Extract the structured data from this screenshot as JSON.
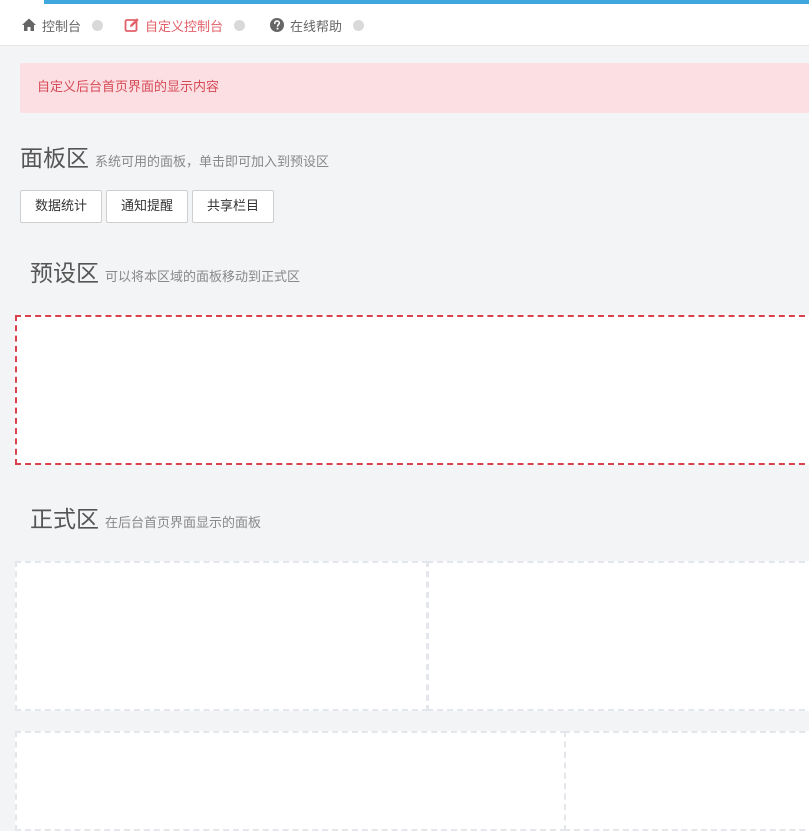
{
  "breadcrumb": {
    "items": [
      {
        "label": "控制台",
        "icon": "home-icon"
      },
      {
        "label": "自定义控制台",
        "icon": "edit-icon",
        "active": true
      },
      {
        "label": "在线帮助",
        "icon": "question-circle-icon"
      }
    ]
  },
  "alert": {
    "text": "自定义后台首页界面的显示内容"
  },
  "panel_section": {
    "title": "面板区",
    "subtitle": "系统可用的面板，单击即可加入到预设区",
    "buttons": [
      "数据统计",
      "通知提醒",
      "共享栏目"
    ]
  },
  "preset_section": {
    "title": "预设区",
    "subtitle": "可以将本区域的面板移动到正式区"
  },
  "formal_section": {
    "title": "正式区",
    "subtitle": "在后台首页界面显示的面板"
  },
  "colors": {
    "accent": "#3fa7dd",
    "active": "#e2606a",
    "alert_bg": "#fcdfe2",
    "preset_border": "#d9414d"
  }
}
